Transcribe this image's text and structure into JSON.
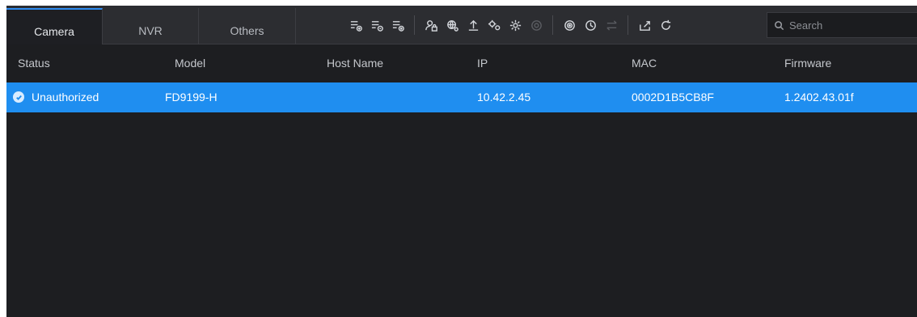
{
  "tabs": [
    {
      "label": "Camera",
      "active": true
    },
    {
      "label": "NVR",
      "active": false
    },
    {
      "label": "Others",
      "active": false
    }
  ],
  "toolbar": {
    "icons": [
      "add-list-icon",
      "edit-list-icon",
      "delete-list-icon",
      "user-lock-icon",
      "network-config-icon",
      "upload-icon",
      "settings-pair-icon",
      "gear-icon",
      "reset-icon",
      "target-icon",
      "clock-icon",
      "swap-icon",
      "export-icon",
      "refresh-icon"
    ]
  },
  "search": {
    "placeholder": "Search"
  },
  "table": {
    "columns": [
      "Status",
      "Model",
      "Host Name",
      "IP",
      "MAC",
      "Firmware"
    ],
    "rows": [
      {
        "status": "Unauthorized",
        "model": "FD9199-H",
        "host_name": "",
        "ip": "10.42.2.45",
        "mac": "0002D1B5CB8F",
        "firmware": "1.2402.43.01f"
      }
    ]
  },
  "colors": {
    "accent": "#1f8ef0",
    "background": "#1d1e21",
    "toolbar": "#2c2d31"
  }
}
